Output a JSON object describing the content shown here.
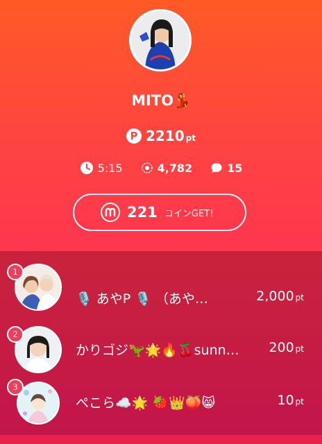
{
  "profile": {
    "name": "MITO",
    "name_emoji": "💃",
    "points": "2210",
    "points_unit": "pt",
    "points_icon": "P"
  },
  "stats": {
    "time": "5:15",
    "views": "4,782",
    "comments": "15"
  },
  "coin_button": {
    "value": "221",
    "label": "コインGET！"
  },
  "ranking": [
    {
      "rank": "1",
      "name": "🎙️ あやP 🎙️ （あや…",
      "points": "2,000",
      "unit": "pt"
    },
    {
      "rank": "2",
      "name": "かりゴジ🦖🌟🔥🍒sunn…",
      "points": "200",
      "unit": "pt"
    },
    {
      "rank": "3",
      "name": "ぺこら☁️🌟 🍓👑🍑😸",
      "points": "10",
      "unit": "pt"
    }
  ],
  "colors": {
    "gradient_top": "#ff5a26",
    "gradient_bottom": "#ff3550",
    "ranking_bg": "#c3154b",
    "badge": "#ef3e5a"
  }
}
